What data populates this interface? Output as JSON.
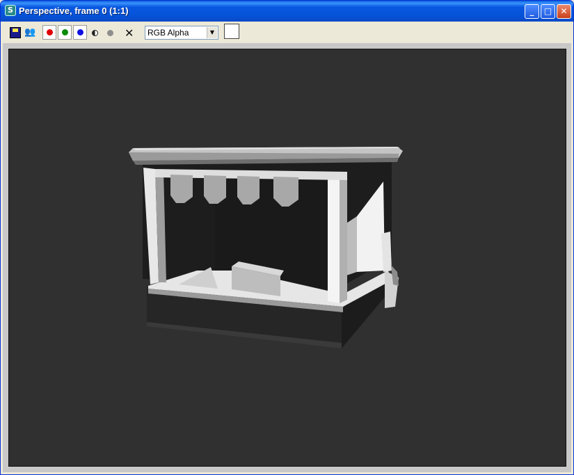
{
  "window": {
    "title": "Perspective, frame 0 (1:1)",
    "buttons": {
      "minimize": "_",
      "maximize": "□",
      "close": "✕"
    }
  },
  "toolbar": {
    "save_icon": "save-icon",
    "clone_icon": "clone-icon",
    "channels": [
      {
        "name": "red-channel-button",
        "color": "#e00000"
      },
      {
        "name": "green-channel-button",
        "color": "#0a8a0a"
      },
      {
        "name": "blue-channel-button",
        "color": "#1010e0"
      }
    ],
    "monochrome_icon": "monochrome-icon",
    "clear_icon": "✕",
    "channel_select": {
      "value": "RGB Alpha",
      "arrow": "▼"
    },
    "background_swatch_color": "#ffffff"
  },
  "viewport": {
    "background_color": "#303030",
    "content": "rendered 3D market stall model"
  }
}
